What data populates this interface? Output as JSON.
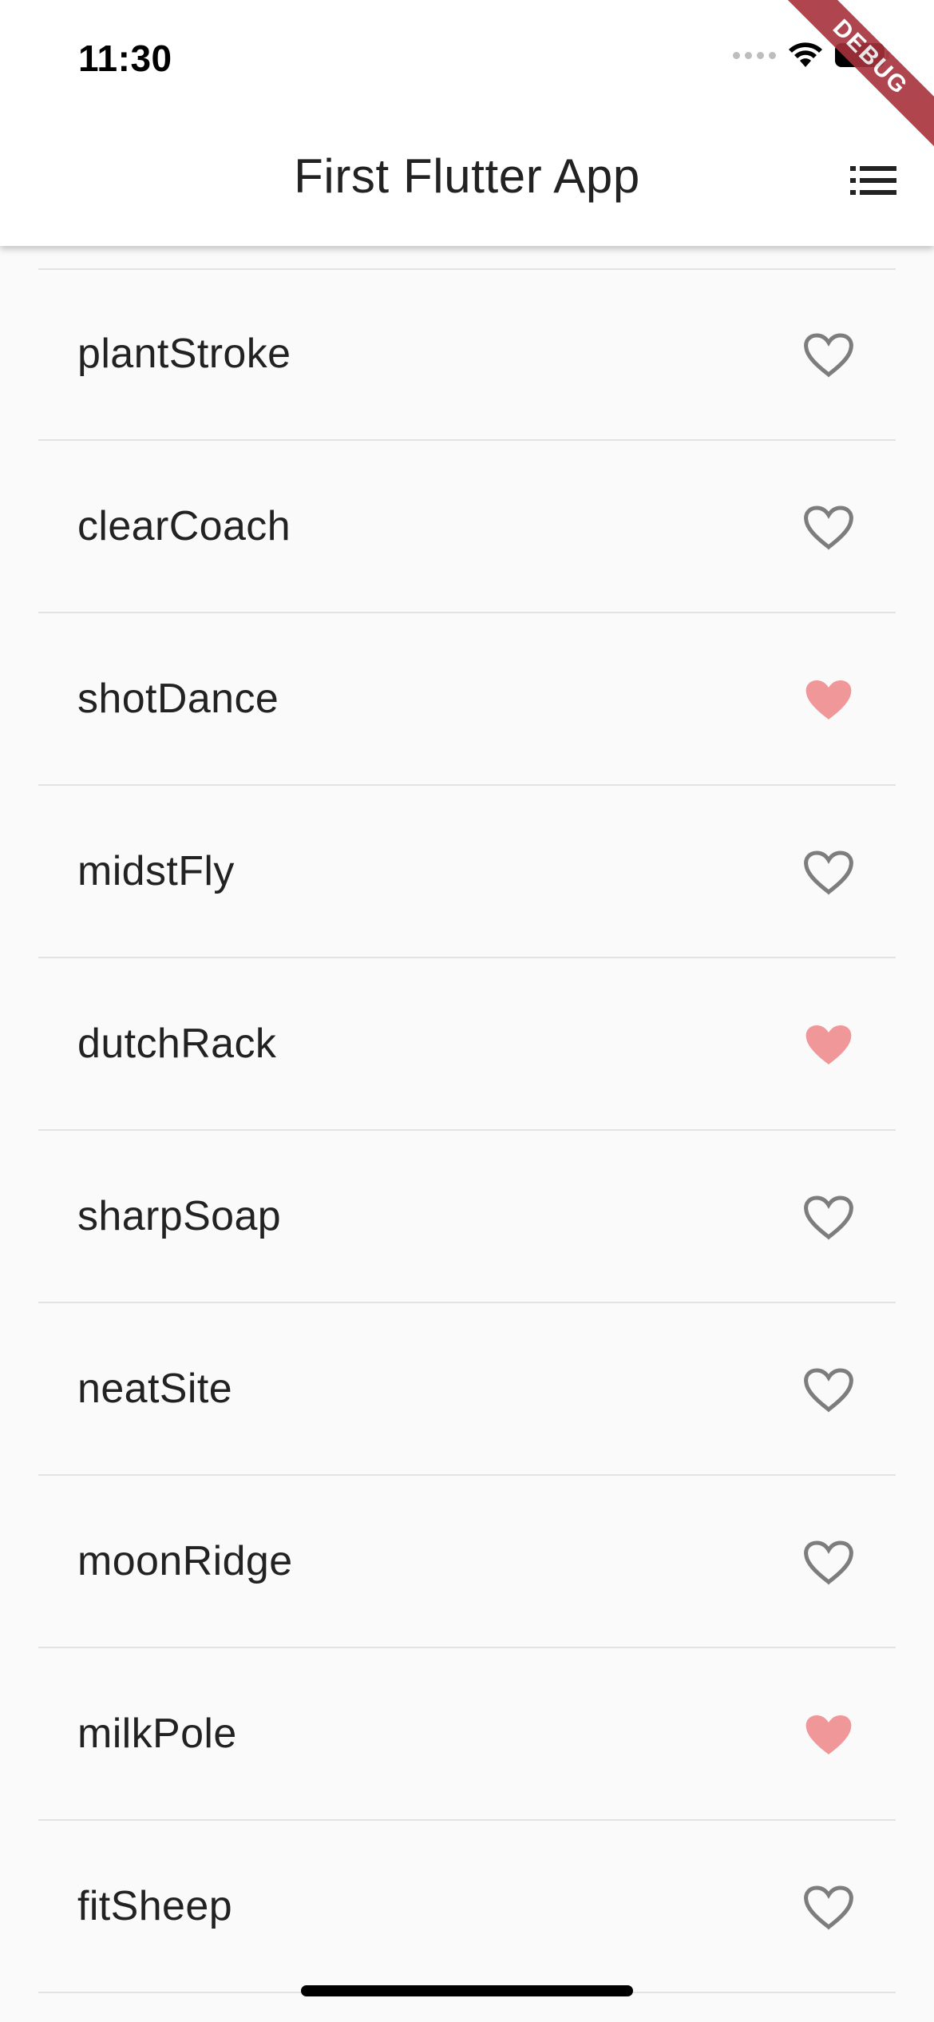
{
  "status_bar": {
    "time": "11:30"
  },
  "app_bar": {
    "title": "First Flutter App",
    "list_icon": "list-icon"
  },
  "debug_banner": "DEBUG",
  "colors": {
    "favorite_fill": "#f0979a",
    "unfavorite_stroke": "#7d7d7d",
    "debug_banner": "#a7313b"
  },
  "items": [
    {
      "label": "plantStroke",
      "favorited": false
    },
    {
      "label": "clearCoach",
      "favorited": false
    },
    {
      "label": "shotDance",
      "favorited": true
    },
    {
      "label": "midstFly",
      "favorited": false
    },
    {
      "label": "dutchRack",
      "favorited": true
    },
    {
      "label": "sharpSoap",
      "favorited": false
    },
    {
      "label": "neatSite",
      "favorited": false
    },
    {
      "label": "moonRidge",
      "favorited": false
    },
    {
      "label": "milkPole",
      "favorited": true
    },
    {
      "label": "fitSheep",
      "favorited": false
    }
  ]
}
